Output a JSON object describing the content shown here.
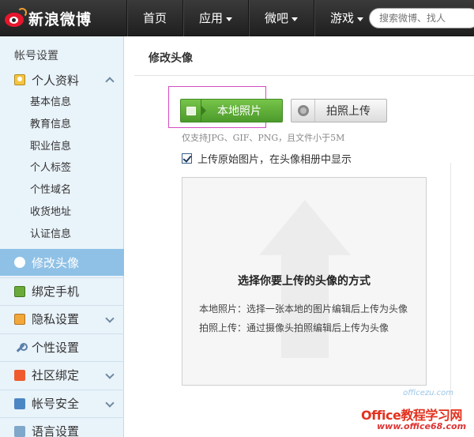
{
  "header": {
    "logo_text": "新浪微博",
    "nav": [
      {
        "label": "首页",
        "dropdown": false
      },
      {
        "label": "应用",
        "dropdown": true
      },
      {
        "label": "微吧",
        "dropdown": true
      },
      {
        "label": "游戏",
        "dropdown": true
      }
    ],
    "search_placeholder": "搜索微博、找人"
  },
  "sidebar": {
    "title": "帐号设置",
    "sections": [
      {
        "label": "个人资料",
        "icon": "profile-icon",
        "expanded": true
      },
      {
        "label": "修改头像",
        "icon": "avatar-icon",
        "active": true
      },
      {
        "label": "绑定手机",
        "icon": "phone-icon"
      },
      {
        "label": "隐私设置",
        "icon": "lock-icon",
        "expandable": true
      },
      {
        "label": "个性设置",
        "icon": "wrench-icon"
      },
      {
        "label": "社区绑定",
        "icon": "community-icon",
        "expandable": true
      },
      {
        "label": "帐号安全",
        "icon": "shield-icon",
        "expandable": true
      },
      {
        "label": "语言设置",
        "icon": "language-icon"
      }
    ],
    "profile_items": [
      "基本信息",
      "教育信息",
      "职业信息",
      "个人标签",
      "个性域名",
      "收货地址",
      "认证信息"
    ]
  },
  "main": {
    "title": "修改头像",
    "btn_local": "本地照片",
    "btn_camera": "拍照上传",
    "hint": "仅支持JPG、GIF、PNG，且文件小于5M",
    "checkbox_label": "上传原始图片，在头像相册中显示",
    "checkbox_checked": true,
    "drop_title": "选择你要上传的头像的方式",
    "drop_line1": "本地照片：选择一张本地的图片编辑后上传为头像",
    "drop_line2": "拍照上传：通过摄像头拍照编辑后上传为头像"
  },
  "watermark": {
    "small": "officezu.com",
    "big": "Office教程学习网",
    "url": "www.office68.com"
  },
  "colors": {
    "topbar": "#2a2a2a",
    "sidebar_bg": "#e9f3fa",
    "sidebar_active": "#8fc1e6",
    "btn_green": "#5aaa34",
    "highlight_frame": "#d44cc0",
    "watermark_red": "#e3311e"
  }
}
